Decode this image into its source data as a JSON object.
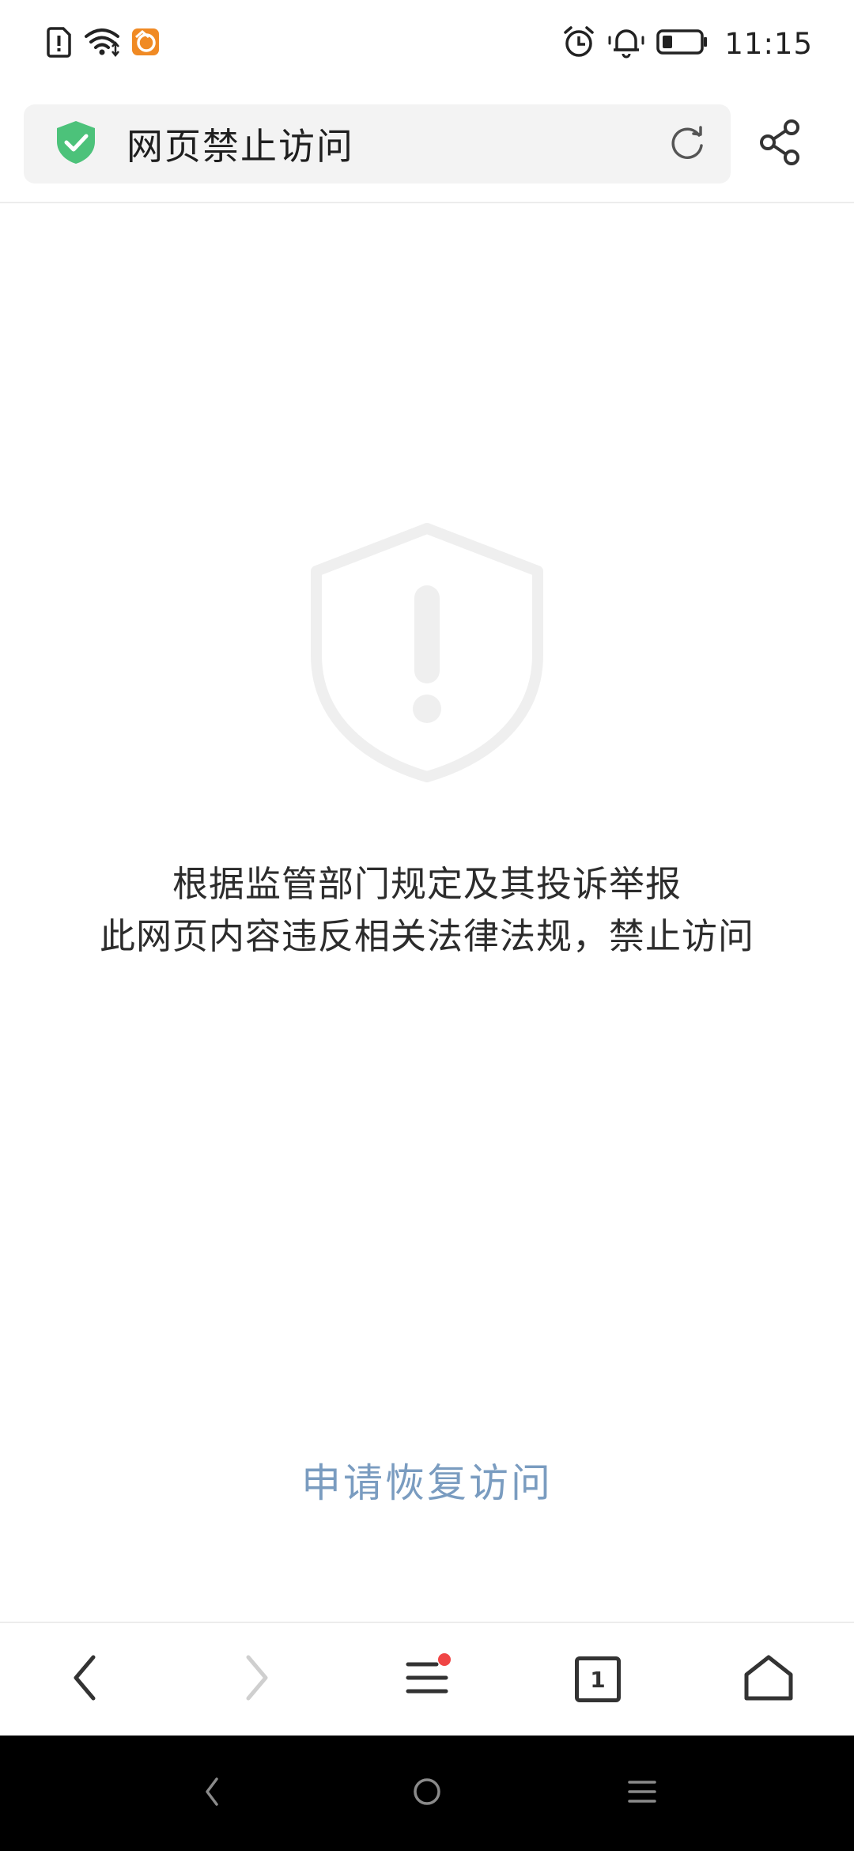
{
  "status_bar": {
    "time": "11:15",
    "left_icons": [
      "sim-alert-icon",
      "wifi-icon",
      "app-notification-icon"
    ],
    "right_icons": [
      "alarm-icon",
      "bell-icon",
      "battery-icon"
    ]
  },
  "address_bar": {
    "title": "网页禁止访问",
    "security_icon": "shield-check-icon",
    "reload_icon": "reload-icon",
    "share_icon": "share-icon"
  },
  "main": {
    "icon": "shield-exclamation-icon",
    "message_line1": "根据监管部门规定及其投诉举报",
    "message_line2": "此网页内容违反相关法律法规，禁止访问",
    "appeal_link": "申请恢复访问"
  },
  "toolbar": {
    "tab_count": "1",
    "items": [
      "back-icon",
      "forward-icon",
      "menu-icon",
      "tabs-icon",
      "home-icon"
    ]
  },
  "colors": {
    "accent_link": "#7a9cc0",
    "shield_green": "#4cc27a",
    "notification_dot": "#f04545"
  }
}
